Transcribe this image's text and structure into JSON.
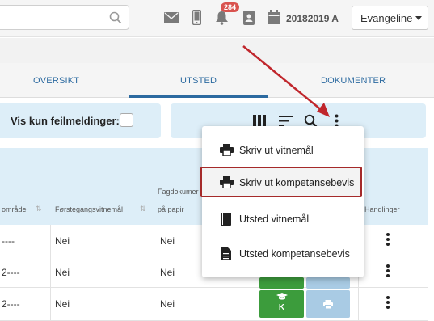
{
  "topbar": {
    "notification_count": "284",
    "school_year": "20182019 A",
    "user_name": "Evangeline"
  },
  "tabs": [
    {
      "label": "OVERSIKT"
    },
    {
      "label": "UTSTED"
    },
    {
      "label": "DOKUMENTER"
    }
  ],
  "filter": {
    "label": "Vis kun feilmeldinger:"
  },
  "table": {
    "headers": {
      "col1": "område",
      "col2": "Førstegangsvitnemål",
      "col3_line1": "Fagdokumer",
      "col3_line2": "på papir",
      "col5": "Handlinger"
    },
    "rows": [
      {
        "col1": "----",
        "col2": "Nei",
        "col3": "Nei"
      },
      {
        "col1": "2----",
        "col2": "Nei",
        "col3": "Nei"
      },
      {
        "col1": "2----",
        "col2": "Nei",
        "col3": "Nei",
        "k_label": "K"
      }
    ],
    "k_label": "K"
  },
  "menu": {
    "items": [
      {
        "label": "Skriv ut vitnemål",
        "icon": "print-icon"
      },
      {
        "label": "Skriv ut kompetansebevis",
        "icon": "print-icon",
        "highlighted": true
      },
      {
        "label": "Utsted vitnemål",
        "icon": "book-icon"
      },
      {
        "label": "Utsted kompetansebevis",
        "icon": "document-icon"
      }
    ]
  },
  "colors": {
    "accent_blue": "#2c6aa0",
    "light_blue": "#ddeef8",
    "green": "#3c9c3c",
    "annotation_red": "#c0262c",
    "badge_red": "#d9534f"
  }
}
